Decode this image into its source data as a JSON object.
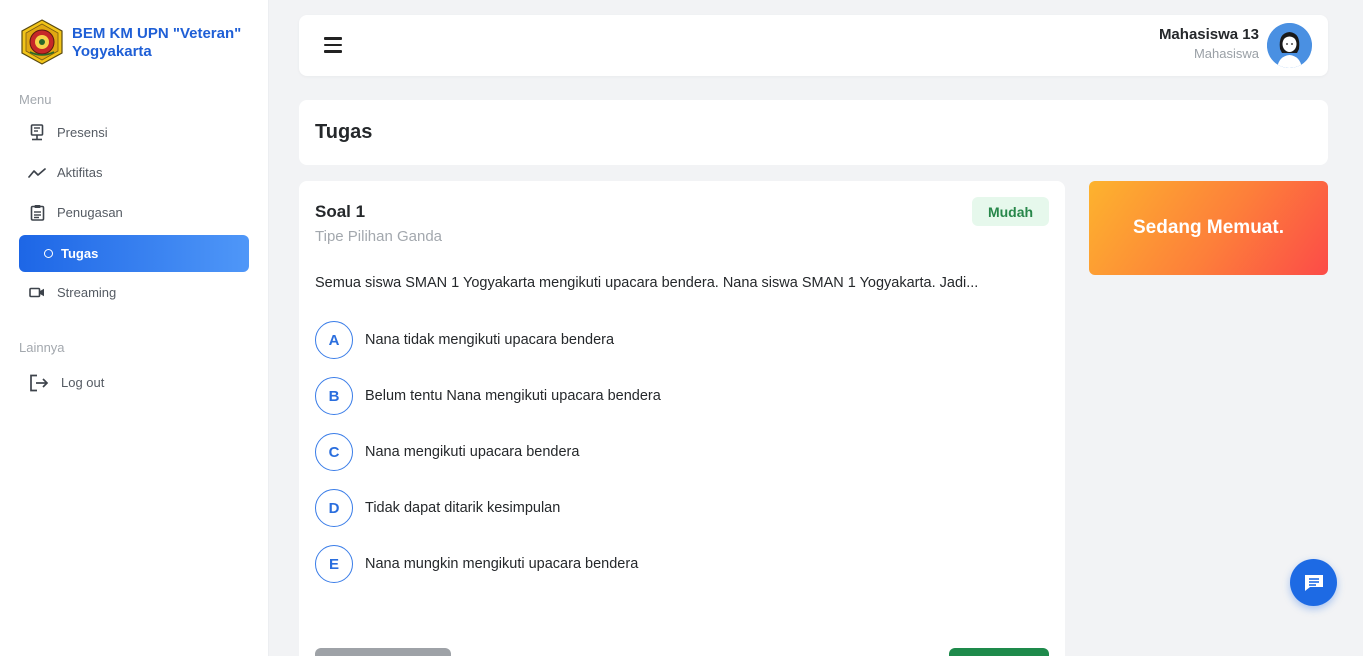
{
  "brand": {
    "name": "BEM KM UPN \"Veteran\" Yogyakarta"
  },
  "sidebar": {
    "menu_label": "Menu",
    "items": [
      {
        "label": "Presensi",
        "icon": "presentation-icon"
      },
      {
        "label": "Aktifitas",
        "icon": "activity-icon"
      },
      {
        "label": "Penugasan",
        "icon": "clipboard-icon"
      },
      {
        "label": "Tugas",
        "icon": "circle-icon",
        "active": true
      },
      {
        "label": "Streaming",
        "icon": "video-icon"
      }
    ],
    "other_label": "Lainnya",
    "logout_label": "Log out"
  },
  "header": {
    "user_name": "Mahasiswa 13",
    "user_role": "Mahasiswa"
  },
  "page": {
    "title": "Tugas"
  },
  "question": {
    "title": "Soal 1",
    "type": "Tipe Pilihan Ganda",
    "difficulty": "Mudah",
    "text": "Semua siswa SMAN 1 Yogyakarta mengikuti upacara bendera. Nana siswa SMAN 1 Yogyakarta. Jadi...",
    "options": [
      {
        "letter": "A",
        "text": "Nana tidak mengikuti upacara bendera"
      },
      {
        "letter": "B",
        "text": "Belum tentu Nana mengikuti upacara bendera"
      },
      {
        "letter": "C",
        "text": "Nana mengikuti upacara bendera"
      },
      {
        "letter": "D",
        "text": "Tidak dapat ditarik kesimpulan"
      },
      {
        "letter": "E",
        "text": "Nana mungkin mengikuti upacara bendera"
      }
    ]
  },
  "status": {
    "text": "Sedang Memuat."
  },
  "colors": {
    "accent": "#1d66e6",
    "badge_bg": "#e6f8ec",
    "badge_text": "#27874a",
    "next_button": "#1e8a4b",
    "prev_button": "#9ea2a7"
  }
}
